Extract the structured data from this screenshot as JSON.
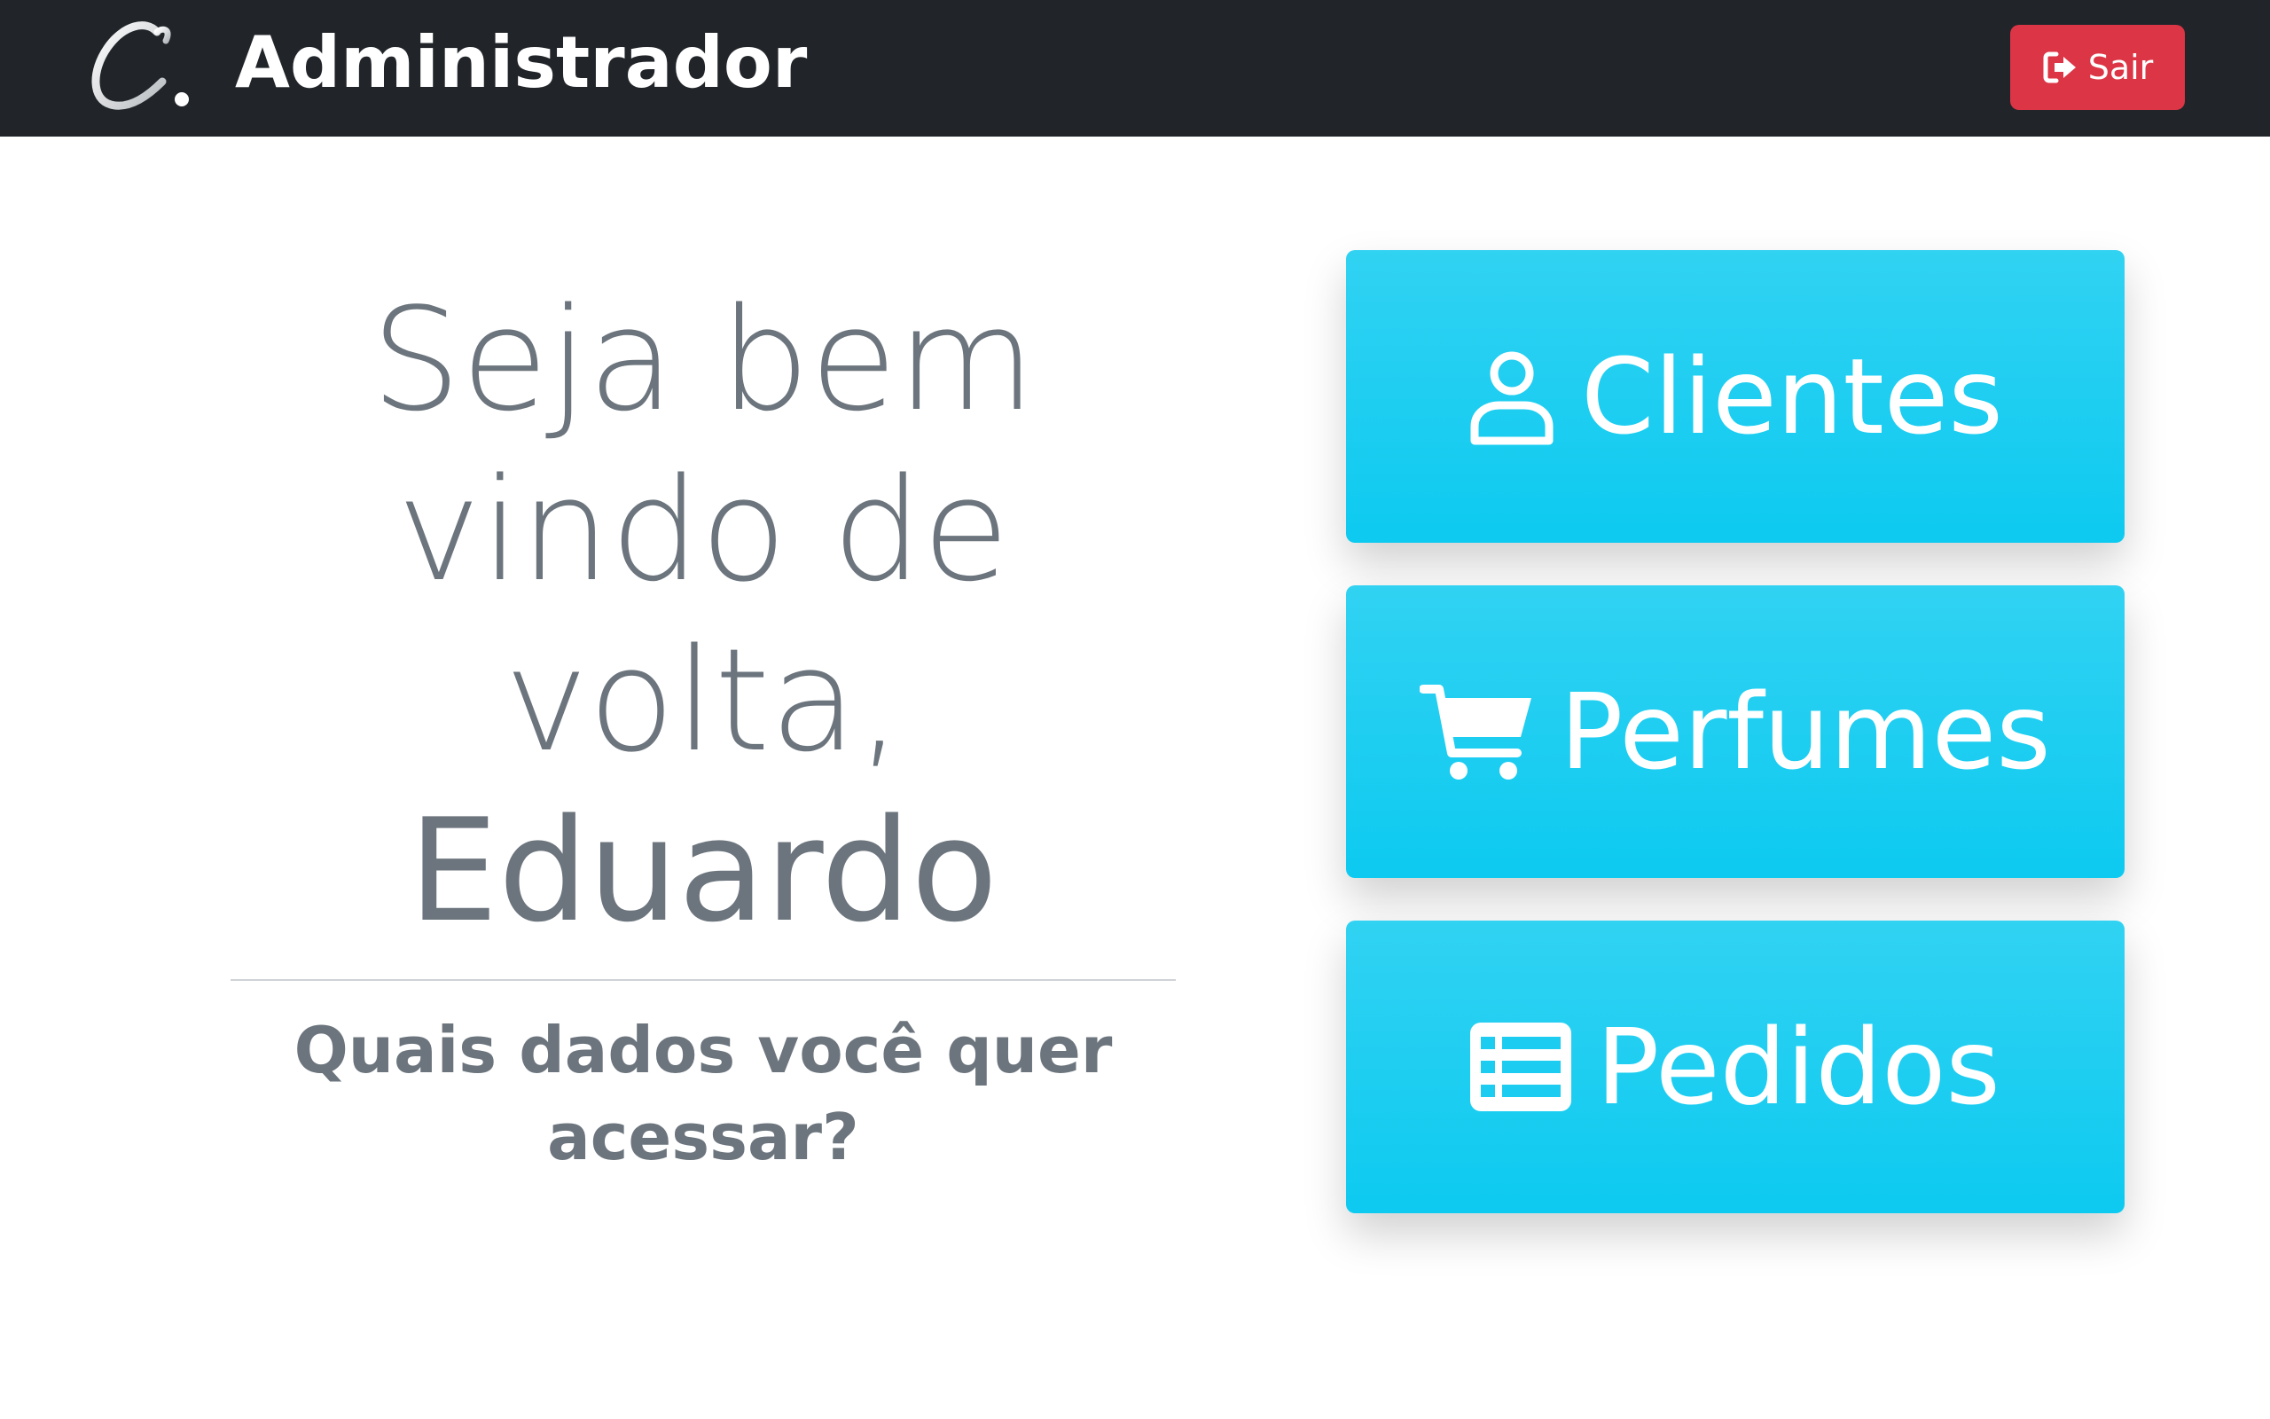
{
  "header": {
    "brand_title": "Administrador",
    "logout_label": "Sair",
    "background_color": "#212529",
    "logout_color": "#dc3545"
  },
  "welcome": {
    "line1": "Seja bem",
    "line2": "vindo de",
    "line3": "volta,",
    "name": "Eduardo",
    "question": "Quais dados você quer acessar?"
  },
  "menu": {
    "accent_color": "#0dcaf0",
    "items": [
      {
        "label": "Clientes",
        "icon": "user-icon"
      },
      {
        "label": "Perfumes",
        "icon": "cart-icon"
      },
      {
        "label": "Pedidos",
        "icon": "list-icon"
      }
    ]
  }
}
